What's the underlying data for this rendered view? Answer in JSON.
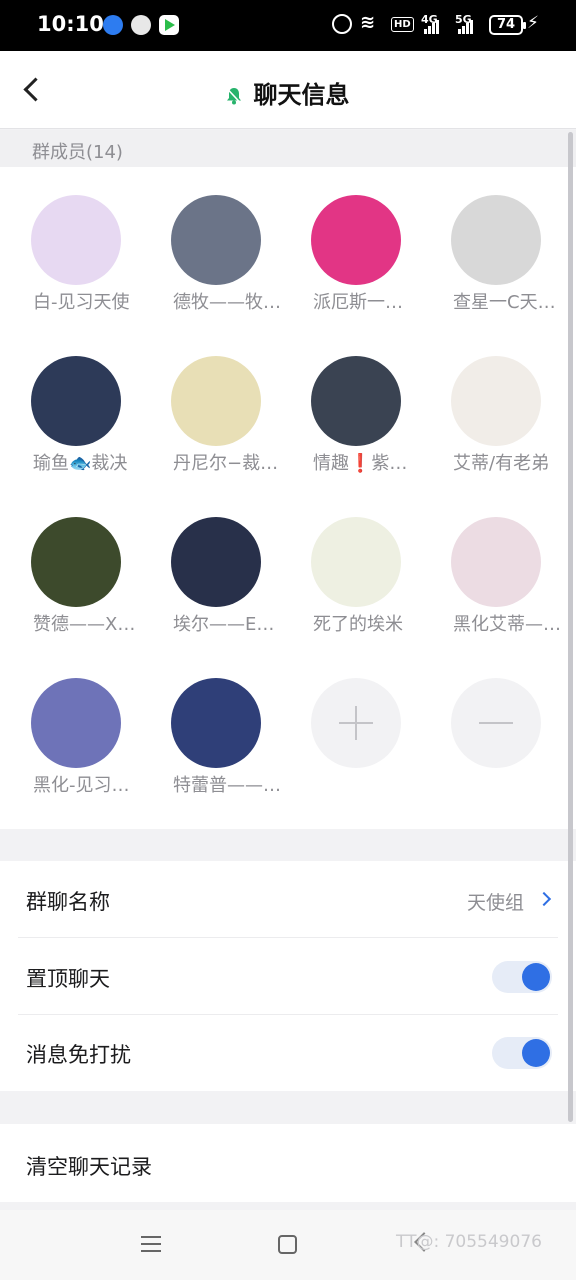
{
  "status_bar": {
    "time": "10:10",
    "hd": "HD",
    "net1": "4G",
    "net2": "5G",
    "battery": "74"
  },
  "header": {
    "title": "聊天信息"
  },
  "members_section": {
    "label": "群成员(14)"
  },
  "members": [
    {
      "name": "白-见习天使",
      "color": "#e7d9f2"
    },
    {
      "name": "德牧——牧…",
      "color": "#6b7488"
    },
    {
      "name": "派厄斯一…",
      "color": "#e23585"
    },
    {
      "name": "查星一C天…",
      "color": "#d8d8d8"
    },
    {
      "name": "瑜鱼🐟裁决",
      "color": "#2d3a58"
    },
    {
      "name": "丹尼尔−裁…",
      "color": "#e8dfb6"
    },
    {
      "name": "情趣❗紫…",
      "color": "#3a4352"
    },
    {
      "name": "艾蒂/有老弟",
      "color": "#f1ede8"
    },
    {
      "name": "赞德——X…",
      "color": "#3d4a2c"
    },
    {
      "name": "埃尔——E…",
      "color": "#28304a"
    },
    {
      "name": "死了的埃米",
      "color": "#eef0e2"
    },
    {
      "name": "黑化艾蒂—…",
      "color": "#ecdce3"
    },
    {
      "name": "黑化-见习…",
      "color": "#6e73b8"
    },
    {
      "name": "特蕾普——…",
      "color": "#2f3f78"
    }
  ],
  "actions": {
    "add": "add-member",
    "remove": "remove-member"
  },
  "settings": {
    "group_name_label": "群聊名称",
    "group_name_value": "天使组",
    "pin_label": "置顶聊天",
    "pin_on": true,
    "mute_label": "消息免打扰",
    "mute_on": true,
    "clear_label": "清空聊天记录"
  },
  "watermark": "TT@: 705549076",
  "colors": {
    "accent": "#2f6fe4",
    "bell": "#27b36c"
  }
}
